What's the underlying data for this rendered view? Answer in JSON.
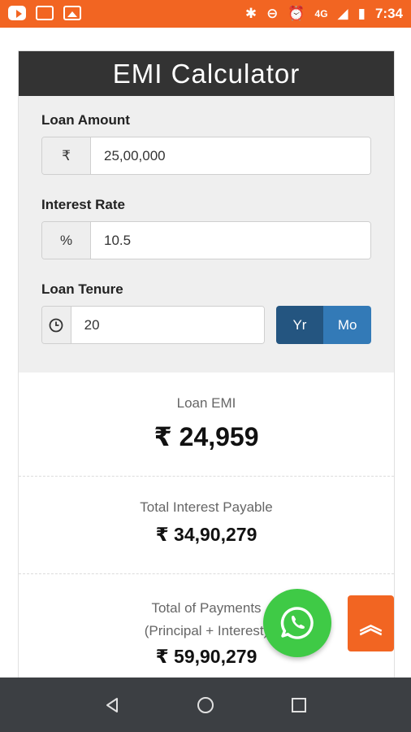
{
  "status_bar": {
    "network": "4G",
    "time": "7:34",
    "left_icons": [
      "youtube-icon",
      "gallery-icon",
      "image-icon"
    ],
    "right_icons": [
      "bluetooth-icon",
      "dnd-icon",
      "alarm-icon",
      "signal-icon",
      "battery-icon"
    ]
  },
  "header": {
    "title": "EMI Calculator"
  },
  "form": {
    "loan_amount": {
      "label": "Loan Amount",
      "addon": "₹",
      "value": "25,00,000"
    },
    "interest_rate": {
      "label": "Interest Rate",
      "addon": "%",
      "value": "10.5"
    },
    "loan_tenure": {
      "label": "Loan Tenure",
      "value": "20",
      "toggle": {
        "year": "Yr",
        "month": "Mo",
        "selected": "Yr"
      }
    }
  },
  "results": {
    "emi": {
      "label": "Loan EMI",
      "value": "₹ 24,959"
    },
    "total_interest": {
      "label": "Total Interest Payable",
      "value": "₹ 34,90,279"
    },
    "total_payments": {
      "label": "Total of Payments",
      "sublabel": "(Principal + Interest)",
      "value": "₹ 59,90,279"
    }
  },
  "floating": {
    "whatsapp_color": "#3fca46",
    "scroll_top_glyph": "︽"
  },
  "colors": {
    "accent": "#f26522",
    "header_bg": "#333333",
    "toggle_active": "#245580",
    "toggle_inactive": "#337ab7"
  }
}
